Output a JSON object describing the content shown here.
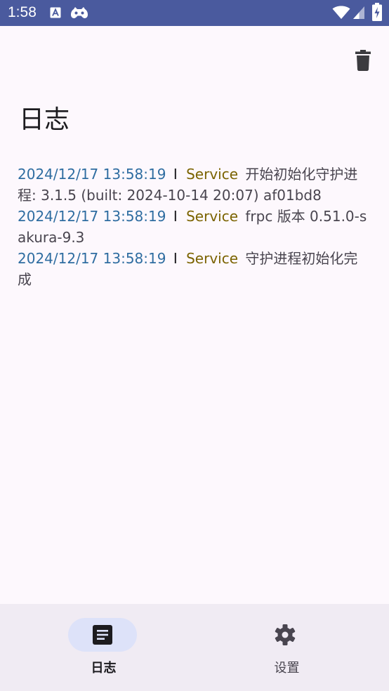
{
  "status_bar": {
    "time": "1:58",
    "icons": [
      "keyboard-a-icon",
      "game-controller-icon",
      "wifi-icon",
      "signal-icon",
      "battery-icon"
    ]
  },
  "app_bar": {
    "action_icon": "delete-icon"
  },
  "page": {
    "title": "日志"
  },
  "logs": [
    {
      "time": "2024/12/17 13:58:19",
      "level": "I",
      "tag": "Service",
      "message": "开始初始化守护进程: 3.1.5 (built: 2024-10-14 20:07) af01bd8"
    },
    {
      "time": "2024/12/17 13:58:19",
      "level": "I",
      "tag": "Service",
      "message": "frpc 版本 0.51.0-sakura-9.3"
    },
    {
      "time": "2024/12/17 13:58:19",
      "level": "I",
      "tag": "Service",
      "message": "守护进程初始化完成"
    }
  ],
  "bottom_nav": {
    "items": [
      {
        "label": "日志",
        "icon": "article-icon",
        "selected": true
      },
      {
        "label": "设置",
        "icon": "gear-icon",
        "selected": false
      }
    ]
  },
  "colors": {
    "status_bar": "#4a5a9e",
    "background": "#fdf8fd",
    "timestamp": "#2f6da1",
    "tag": "#7b6300",
    "message": "#49454f",
    "nav_background": "#f0ebf3",
    "nav_indicator": "#dde2f9"
  }
}
